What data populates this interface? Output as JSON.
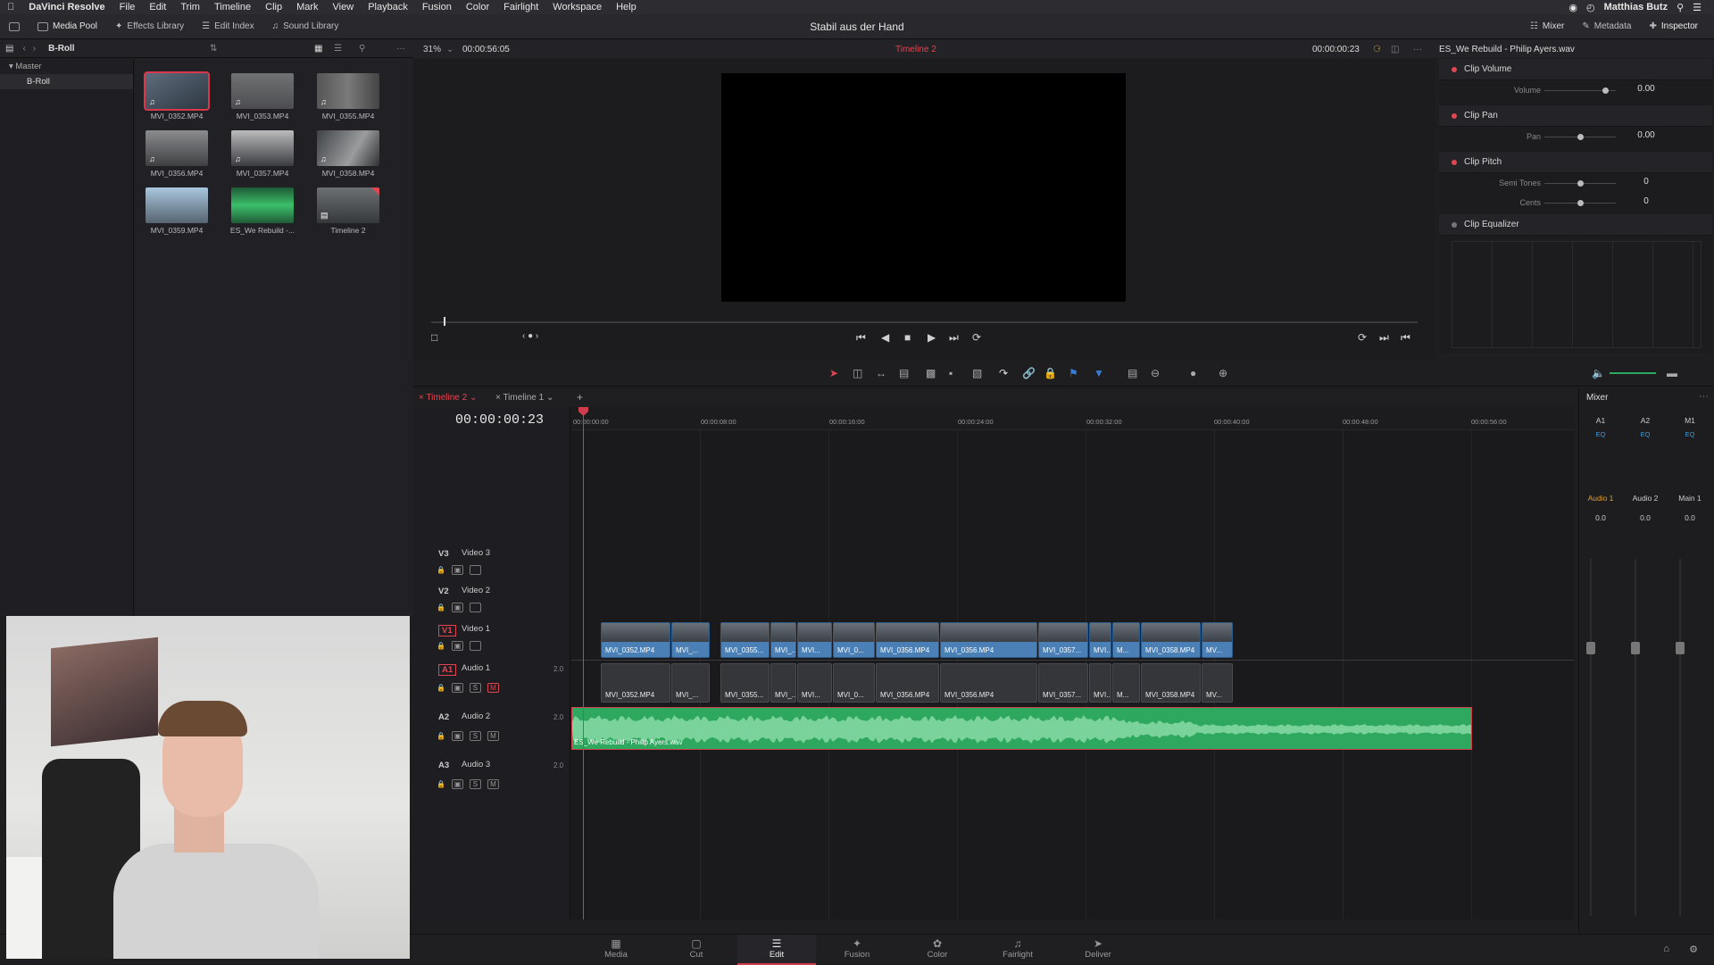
{
  "menubar": {
    "apple": "",
    "app": "DaVinci Resolve",
    "items": [
      "File",
      "Edit",
      "Trim",
      "Timeline",
      "Clip",
      "Mark",
      "View",
      "Playback",
      "Fusion",
      "Color",
      "Fairlight",
      "Workspace",
      "Help"
    ],
    "user": "Matthias Butz"
  },
  "topbar": {
    "media_pool": "Media Pool",
    "effects": "Effects Library",
    "edit_index": "Edit Index",
    "sound": "Sound Library",
    "project_title": "Stabil aus der Hand",
    "mixer": "Mixer",
    "metadata": "Metadata",
    "inspector": "Inspector"
  },
  "pool": {
    "bin_name": "B-Roll",
    "bins": [
      "Master",
      "B-Roll"
    ],
    "clips": [
      "MVI_0352.MP4",
      "MVI_0353.MP4",
      "MVI_0355.MP4",
      "MVI_0356.MP4",
      "MVI_0357.MP4",
      "MVI_0358.MP4",
      "MVI_0359.MP4",
      "ES_We Rebuild -...",
      "Timeline 2"
    ]
  },
  "viewer": {
    "zoom": "31%",
    "source_tc": "00:00:56:05",
    "timeline_name": "Timeline 2",
    "record_tc": "00:00:00:23"
  },
  "inspector": {
    "clip_name": "ES_We Rebuild - Philip Ayers.wav",
    "volume": {
      "title": "Clip Volume",
      "label": "Volume",
      "value": "0.00",
      "level": 0.85
    },
    "pan": {
      "title": "Clip Pan",
      "label": "Pan",
      "value": "0.00",
      "level": 0.5
    },
    "pitch": {
      "title": "Clip Pitch",
      "semi_label": "Semi Tones",
      "semi_value": "0",
      "cents_label": "Cents",
      "cents_value": "0"
    },
    "eq": {
      "title": "Clip Equalizer"
    }
  },
  "timeline": {
    "tabs": [
      "Timeline 2",
      "Timeline 1"
    ],
    "timecode": "00:00:00:23",
    "ruler": [
      "00:00:00:00",
      "00:00:08:00",
      "00:00:16:00",
      "00:00:24:00",
      "00:00:32:00",
      "00:00:40:00",
      "00:00:48:00",
      "00:00:56:00"
    ],
    "tracks": [
      {
        "id": "V3",
        "name": "Video 3"
      },
      {
        "id": "V2",
        "name": "Video 2"
      },
      {
        "id": "V1",
        "name": "Video 1"
      },
      {
        "id": "A1",
        "name": "Audio 1",
        "ch": "2.0"
      },
      {
        "id": "A2",
        "name": "Audio 2",
        "ch": "2.0"
      },
      {
        "id": "A3",
        "name": "Audio 3",
        "ch": "2.0"
      }
    ],
    "video_clips": [
      "MVI_0352.MP4",
      "MVI_...",
      "MVI_0355...",
      "MVI_...",
      "MVI...",
      "MVI_0...",
      "MVI_0356.MP4",
      "MVI_0356.MP4",
      "MVI_0357...",
      "MVI...",
      "M...",
      "MVI_0358.MP4",
      "MV..."
    ],
    "audio_clips": [
      "MVI_0352.MP4",
      "MVI_...",
      "MVI_0355...",
      "MVI_...",
      "MVI...",
      "MVI_0...",
      "MVI_0356.MP4",
      "MVI_0356.MP4",
      "MVI_0357...",
      "MVI...",
      "M...",
      "MVI_0358.MP4",
      "MV..."
    ],
    "music_clip": "ES_We Rebuild - Philip Ayers.wav"
  },
  "mixer": {
    "title": "Mixer",
    "cols": [
      "A1",
      "A2",
      "M1"
    ],
    "names": [
      "Audio 1",
      "Audio 2",
      "Main 1"
    ],
    "eq": "EQ",
    "db": [
      "0.0",
      "0.0",
      "0.0"
    ]
  },
  "pages": [
    "Media",
    "Cut",
    "Edit",
    "Fusion",
    "Color",
    "Fairlight",
    "Deliver"
  ]
}
